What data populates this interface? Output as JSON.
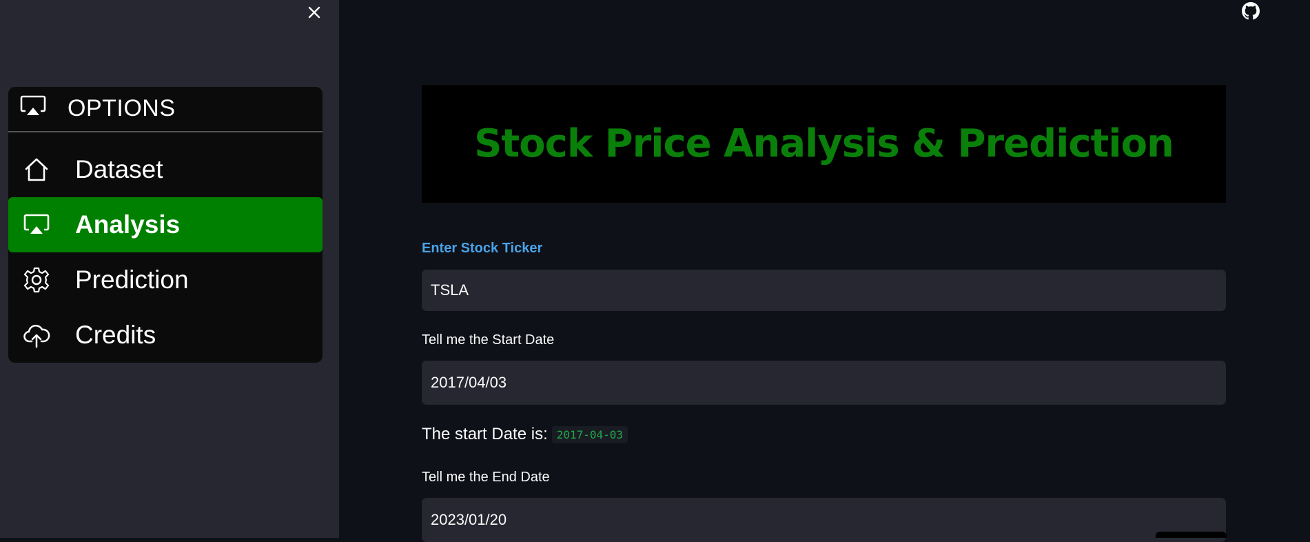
{
  "sidebar": {
    "close_icon": "close-icon",
    "menu_title": "OPTIONS",
    "menu_title_icon": "airplay-icon",
    "items": [
      {
        "label": "Dataset",
        "icon": "home-icon",
        "active": false
      },
      {
        "label": "Analysis",
        "icon": "airplay-icon",
        "active": true
      },
      {
        "label": "Prediction",
        "icon": "gear-icon",
        "active": false
      },
      {
        "label": "Credits",
        "icon": "cloud-upload-icon",
        "active": false
      }
    ]
  },
  "header": {
    "github_icon": "github-icon"
  },
  "main": {
    "title": "Stock Price Analysis & Prediction",
    "ticker_label": "Enter Stock Ticker",
    "ticker_value": "TSLA",
    "start_label": "Tell me the Start Date",
    "start_value": "2017/04/03",
    "start_info_text": "The start Date is:",
    "start_info_code": "2017-04-03",
    "end_label": "Tell me the End Date",
    "end_value": "2023/01/20"
  },
  "colors": {
    "accent_green": "#008000",
    "title_green": "#0a7f0a",
    "label_blue": "#4aa3e8",
    "code_green": "#21a84c",
    "sidebar_bg": "#262730",
    "main_bg": "#0e1117"
  }
}
